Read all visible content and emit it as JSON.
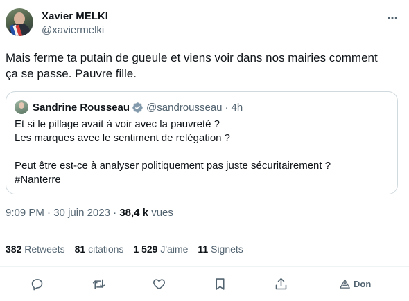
{
  "author": {
    "name": "Xavier MELKI",
    "handle": "@xaviermelki",
    "avatar_icon": "avatar"
  },
  "tweet": {
    "text_lines": [
      "Mais ferme ta putain de gueule et viens voir dans nos mairies comment",
      "ça se passe. Pauvre fille."
    ]
  },
  "quoted": {
    "name": "Sandrine Rousseau",
    "handle": "@sandrousseau",
    "separator": "·",
    "time": "4h",
    "lines": [
      "Et si le pillage avait à voir avec la pauvreté ?",
      "Les marques avec le sentiment de relégation ?",
      "",
      "Peut être est-ce à analyser politiquement pas juste sécuritairement ?",
      "#Nanterre"
    ]
  },
  "meta": {
    "time": "9:09 PM",
    "sep1": " · ",
    "date": "30 juin 2023",
    "sep2": " · ",
    "views_count": "38,4 k",
    "views_label": " vues"
  },
  "stats": {
    "retweets_count": "382",
    "retweets_label": " Retweets",
    "quotes_count": "81",
    "quotes_label": " citations",
    "likes_count": "1 529",
    "likes_label": " J'aime",
    "bookmarks_count": "11",
    "bookmarks_label": " Signets"
  },
  "actions": {
    "donate_label": "Don"
  },
  "colors": {
    "text": "#0f1419",
    "muted": "#536471",
    "border": "#cfd9de",
    "verified": "#829aab"
  }
}
